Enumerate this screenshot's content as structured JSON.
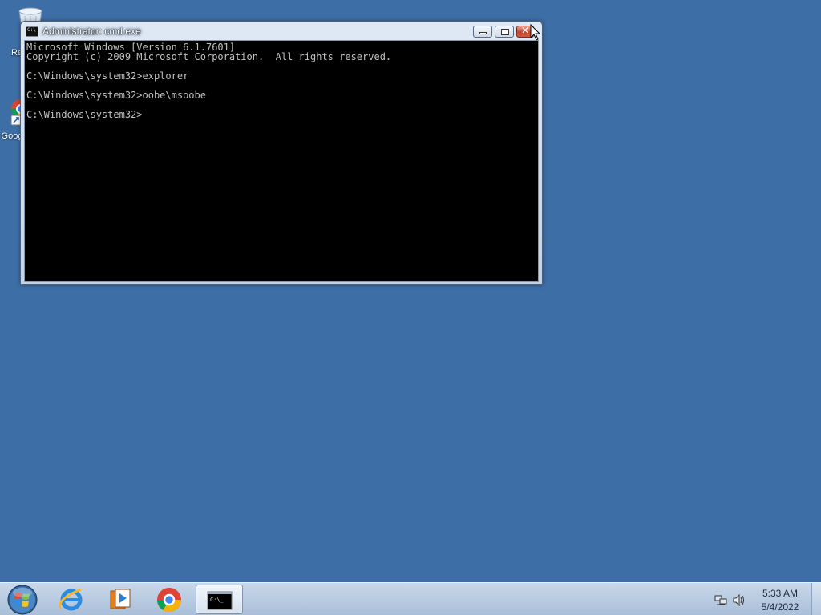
{
  "desktop": {
    "icons": [
      {
        "label": "Re",
        "icon": "recycle-bin-icon"
      },
      {
        "label": "Goog",
        "icon": "google-chrome-shortcut-icon"
      }
    ],
    "background_color": "#3e6ea6"
  },
  "window": {
    "title": "Administrator: cmd.exe",
    "icon": "console-icon",
    "icon_text": "C:\\",
    "buttons": {
      "minimize": "minimize-icon",
      "maximize": "maximize-icon",
      "close": "close-icon",
      "close_glyph": "✕"
    },
    "console": {
      "background": "#000000",
      "foreground": "#c0c0c0",
      "lines": [
        "Microsoft Windows [Version 6.1.7601]",
        "Copyright (c) 2009 Microsoft Corporation.  All rights reserved.",
        "C:\\Windows\\system32>explorer",
        "C:\\Windows\\system32>oobe\\msoobe",
        "C:\\Windows\\system32>"
      ]
    }
  },
  "taskbar": {
    "items": [
      {
        "name": "start",
        "icon": "windows-orb-icon"
      },
      {
        "name": "internet-explorer",
        "icon": "internet-explorer-icon"
      },
      {
        "name": "windows-media-player",
        "icon": "media-player-icon"
      },
      {
        "name": "google-chrome",
        "icon": "chrome-icon"
      },
      {
        "name": "command-prompt",
        "icon": "console-icon",
        "active": true
      }
    ],
    "task_cmd_icon_text": "C:\\_",
    "tray": {
      "icons": [
        "network-icon",
        "volume-icon"
      ],
      "time": "5:33 AM",
      "date": "5/4/2022"
    }
  }
}
